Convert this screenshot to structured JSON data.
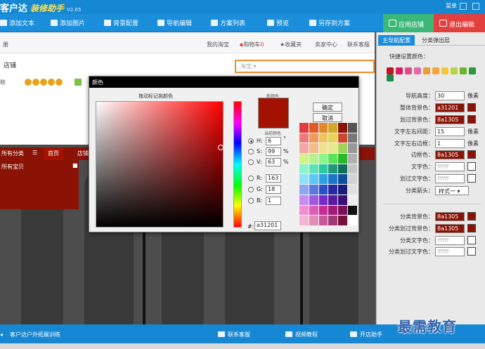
{
  "app": {
    "logo": "客户达",
    "subtitle": "装修助手",
    "version": "V2.65",
    "menu": "菜单"
  },
  "toolbar": {
    "items": [
      "添加文本",
      "添加图片",
      "背景配置",
      "导航编辑",
      "方案列表",
      "预览",
      "另存到方案"
    ],
    "apply": "应用店铺",
    "exit": "退出编辑"
  },
  "shop": {
    "nav_left": "册",
    "my_taobao": "我的淘宝",
    "cart": "购物车",
    "cart_count": "0",
    "favorites": "收藏夹",
    "seller_center": "卖家中心",
    "contact": "联系客服",
    "shop_name": "店铺",
    "search_placeholder": "淘宝",
    "rating_prefix": "称",
    "nav_items": [
      "所有分类",
      "首页",
      "店铺"
    ],
    "dropdown_item": "所有宝贝"
  },
  "dialog": {
    "title": "颜色",
    "hint": "拖动标记挑颜色",
    "new_label": "新颜色",
    "current_label": "当前颜色",
    "confirm": "确定",
    "cancel": "取消",
    "h_label": "H:",
    "h": "6",
    "h_unit": "°",
    "s_label": "S:",
    "s": "99",
    "s_unit": "%",
    "v_label": "V:",
    "v": "63",
    "v_unit": "%",
    "r_label": "R:",
    "r": "163",
    "g_label": "G:",
    "g": "18",
    "b_label": "B:",
    "b": "1",
    "hex_label": "#:",
    "hex": "a31201",
    "new_color": "#a31201",
    "palette": [
      "#e23c3c",
      "#e25a2a",
      "#e2892a",
      "#d4a62a",
      "#8a1305",
      "#555555",
      "#f07a7a",
      "#f09a5a",
      "#f0c35a",
      "#e6d35a",
      "#c94a2a",
      "#777777",
      "#f2a6a6",
      "#f2bc8c",
      "#f2e08c",
      "#e6e68c",
      "#9fd35a",
      "#999999",
      "#d2f28c",
      "#b6f28c",
      "#8cf28c",
      "#5ae25a",
      "#2ab82a",
      "#b0b0b0",
      "#8cf2c8",
      "#5ae2b8",
      "#2ac8a0",
      "#1a9a7a",
      "#0f6f5a",
      "#c4c4c4",
      "#8ce2f2",
      "#5ac8f2",
      "#2aa0e2",
      "#1a78c8",
      "#0f4f9a",
      "#d2d2d2",
      "#8ca6f2",
      "#5a78e2",
      "#2a4fc8",
      "#2a2aa0",
      "#1a1a78",
      "#e0e0e0",
      "#c88cf2",
      "#a05ae2",
      "#782ac8",
      "#5a1aa0",
      "#3a0f78",
      "#eeeeee",
      "#f28cd2",
      "#e25ab8",
      "#c82a9a",
      "#a01a78",
      "#780f5a",
      "#111111",
      "#f2b6d2",
      "#e28cb8",
      "#c85a9a",
      "#a03a78",
      "#780f3a",
      "#ffffff"
    ]
  },
  "panel": {
    "tab_main": "主导航配置",
    "tab_sub": "分类弹出层",
    "quick_colors_label": "快捷设置颜色：",
    "quick_colors": [
      "#c0141e",
      "#d81e5a",
      "#e24a8c",
      "#e66aa8",
      "#f09a3a",
      "#f2a63a",
      "#f2c83a",
      "#b8d24a",
      "#6ab82a",
      "#2a9a3a",
      "#1a8a4a"
    ],
    "nav_height_label": "导航高度：",
    "nav_height": "30",
    "nav_height_unit": "像素",
    "bg_label": "整体背景色：",
    "bg": "a31201",
    "hover_bg_label": "划过背景色：",
    "hover_bg": "8a1305",
    "text_lr_label": "文字左右间距：",
    "text_lr": "15",
    "text_lr_unit": "像素",
    "text_border_label": "文字左右边框：",
    "text_border": "1",
    "text_border_unit": "像素",
    "border_label": "边框色：",
    "border": "8a1305",
    "text_color_label": "文字色：",
    "text_color": "ffffff",
    "hover_text_label": "划过文字色：",
    "hover_text": "ffffff",
    "arrow_label": "分类箭头：",
    "arrow": "样式一",
    "cat_bg_label": "分类背景色：",
    "cat_bg": "8a1305",
    "cat_hover_bg_label": "分类划过背景色：",
    "cat_hover_bg": "8a1305",
    "cat_text_label": "分类文字色：",
    "cat_text": "ffffff",
    "cat_hover_text_label": "分类划过文字色：",
    "cat_hover_text": "ffffff"
  },
  "bottom": {
    "left": "客户达户外拓展训练",
    "service": "联系客服",
    "video": "视频教程",
    "assistant": "开店助手"
  },
  "watermark": "最需教育"
}
